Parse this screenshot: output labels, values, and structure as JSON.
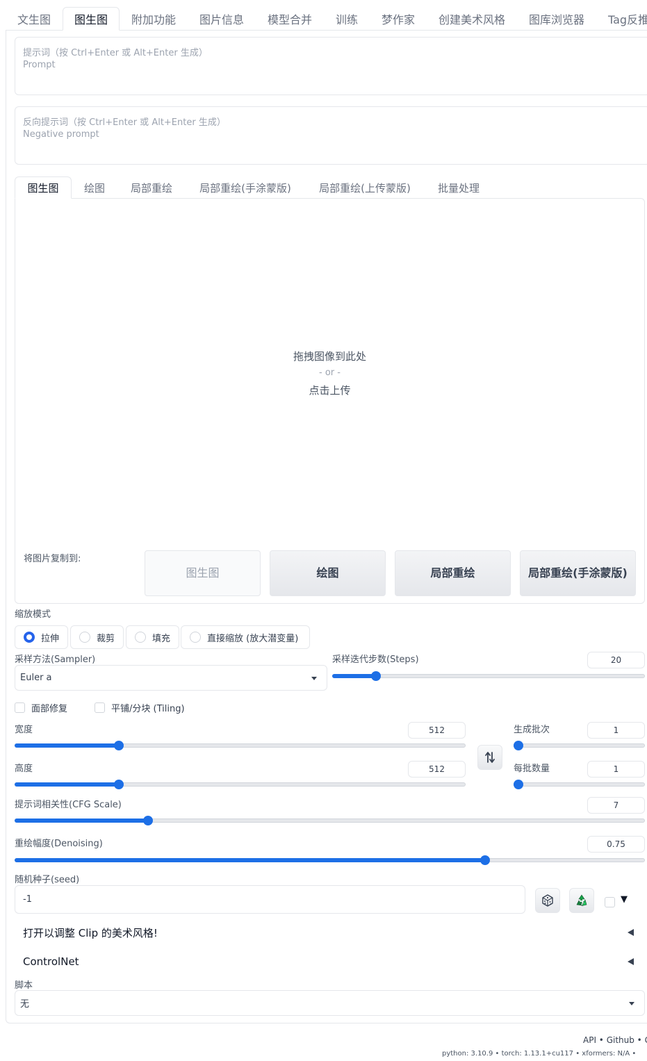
{
  "top_tabs": [
    {
      "label": "文生图",
      "active": false
    },
    {
      "label": "图生图",
      "active": true
    },
    {
      "label": "附加功能",
      "active": false
    },
    {
      "label": "图片信息",
      "active": false
    },
    {
      "label": "模型合并",
      "active": false
    },
    {
      "label": "训练",
      "active": false
    },
    {
      "label": "梦作家",
      "active": false
    },
    {
      "label": "创建美术风格",
      "active": false
    },
    {
      "label": "图库浏览器",
      "active": false
    },
    {
      "label": "Tag反推",
      "active": false
    }
  ],
  "prompt": {
    "label": "提示词（按 Ctrl+Enter 或 Alt+Enter 生成）",
    "placeholder": "Prompt"
  },
  "negative_prompt": {
    "label": "反向提示词（按 Ctrl+Enter 或 Alt+Enter 生成）",
    "placeholder": "Negative prompt"
  },
  "sub_tabs": [
    {
      "label": "图生图",
      "active": true
    },
    {
      "label": "绘图",
      "active": false
    },
    {
      "label": "局部重绘",
      "active": false
    },
    {
      "label": "局部重绘(手涂蒙版)",
      "active": false
    },
    {
      "label": "局部重绘(上传蒙版)",
      "active": false
    },
    {
      "label": "批量处理",
      "active": false
    }
  ],
  "upload": {
    "drop_text": "拖拽图像到此处",
    "or_text": "- or -",
    "click_text": "点击上传"
  },
  "copy_to": {
    "label": "将图片复制到:",
    "buttons": [
      "图生图",
      "绘图",
      "局部重绘",
      "局部重绘(手涂蒙版)"
    ]
  },
  "resize_mode": {
    "label": "缩放模式",
    "options": [
      "拉伸",
      "裁剪",
      "填充",
      "直接缩放 (放大潜变量)"
    ],
    "selected": "拉伸"
  },
  "sampler": {
    "label": "采样方法(Sampler)",
    "value": "Euler a"
  },
  "steps": {
    "label": "采样迭代步数(Steps)",
    "value": "20",
    "min": 1,
    "max": 150,
    "current": 20
  },
  "checkboxes": {
    "face_restore": "面部修复",
    "tiling": "平铺/分块 (Tiling)"
  },
  "width": {
    "label": "宽度",
    "value": "512",
    "min": 64,
    "max": 2048,
    "current": 512
  },
  "height": {
    "label": "高度",
    "value": "512",
    "min": 64,
    "max": 2048,
    "current": 512
  },
  "swap_icon": "swap-vertical-icon",
  "batch_count": {
    "label": "生成批次",
    "value": "1",
    "min": 1,
    "max": 100,
    "current": 1
  },
  "batch_size": {
    "label": "每批数量",
    "value": "1",
    "min": 1,
    "max": 8,
    "current": 1
  },
  "cfg_scale": {
    "label": "提示词相关性(CFG Scale)",
    "value": "7",
    "min": 1,
    "max": 30,
    "current": 7
  },
  "denoising": {
    "label": "重绘幅度(Denoising)",
    "value": "0.75",
    "min": 0,
    "max": 1,
    "current": 0.75
  },
  "seed": {
    "label": "随机种子(seed)",
    "value": "-1",
    "random_icon": "dice-icon",
    "reuse_icon": "recycle-icon",
    "extra_arrow": "▼"
  },
  "accordions": [
    {
      "label": "打开以调整 Clip 的美术风格!"
    },
    {
      "label": "ControlNet"
    }
  ],
  "script": {
    "label": "脚本",
    "value": "无"
  },
  "footer": {
    "links": "API • Github • G",
    "versions": "python: 3.10.9  •  torch: 1.13.1+cu117  •  xformers: N/A  •"
  },
  "colors": {
    "accent": "#1d6fe6",
    "border": "#e5e7eb"
  }
}
